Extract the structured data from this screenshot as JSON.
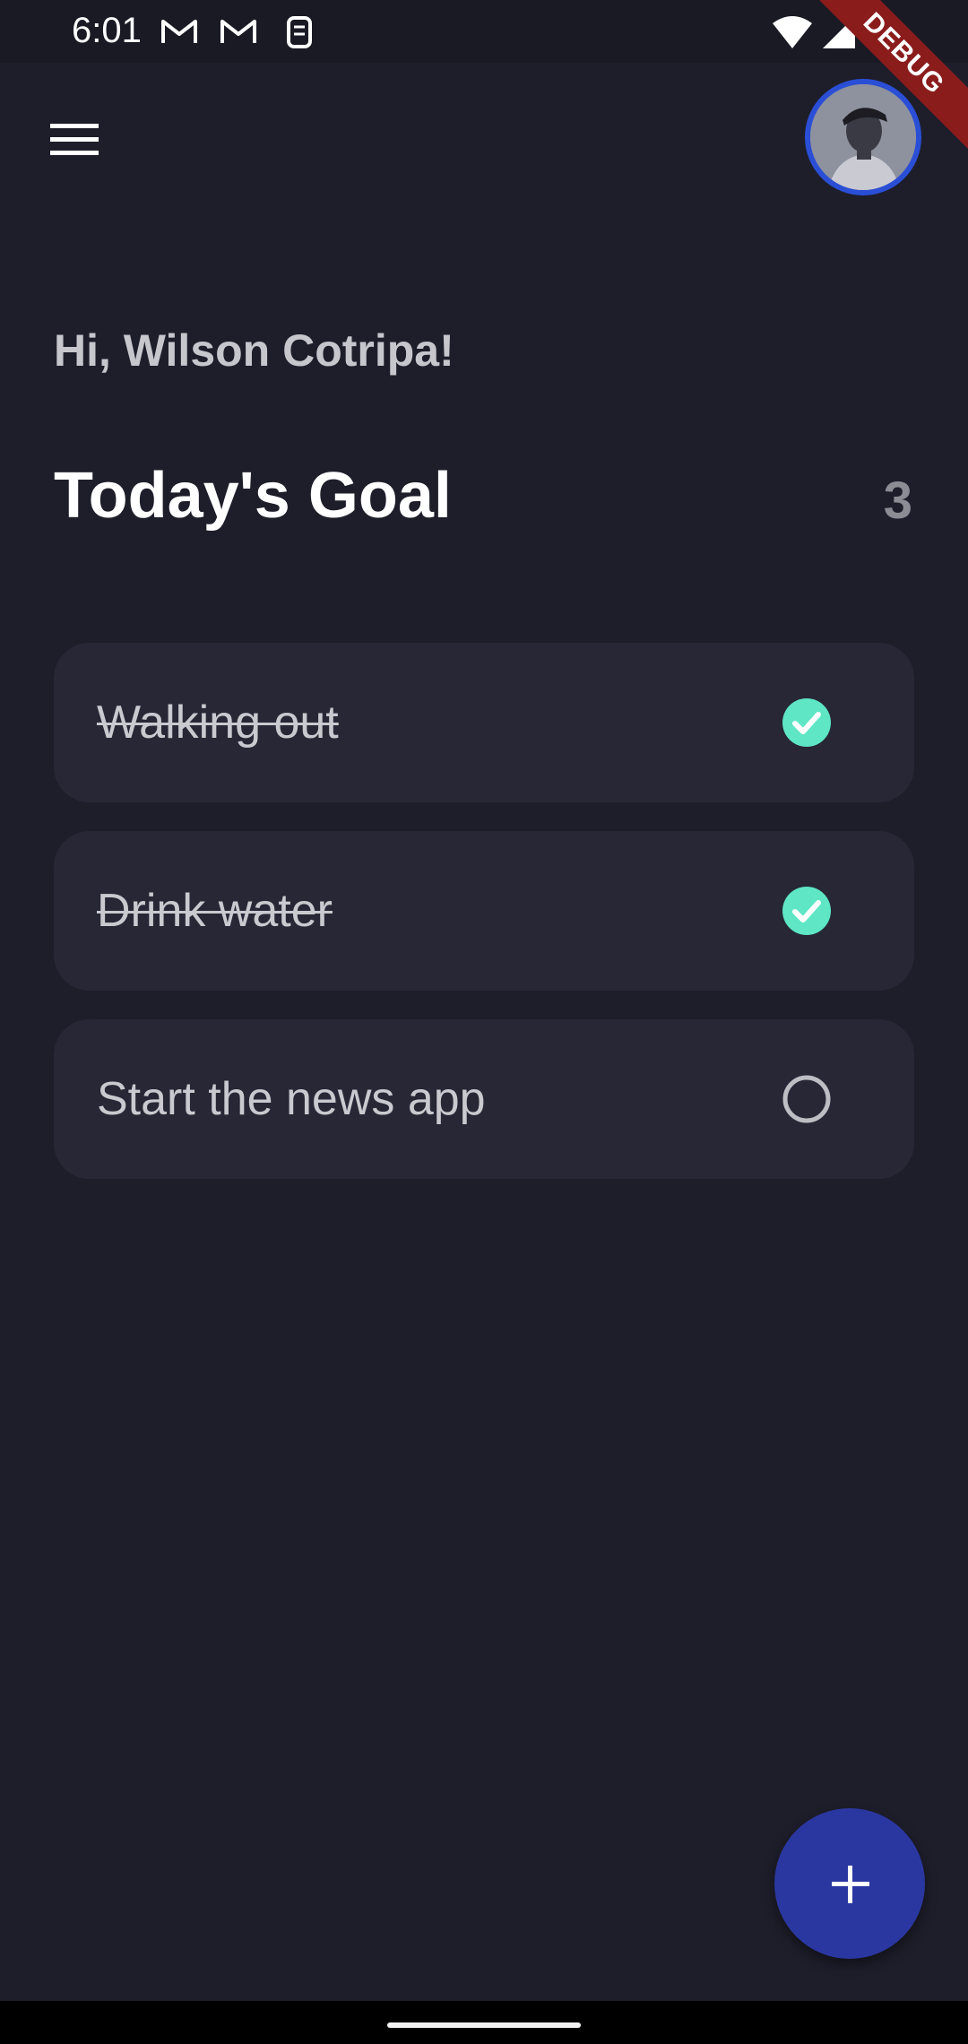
{
  "status_bar": {
    "time": "6:01",
    "icons": [
      "gmail-icon",
      "gmail-icon",
      "sim-icon",
      "wifi-icon",
      "signal-icon",
      "battery-icon"
    ]
  },
  "debug_banner": "DEBUG",
  "app_bar": {
    "menu_icon": "hamburger-menu-icon",
    "avatar": "user-avatar"
  },
  "greeting": "Hi, Wilson Cotripa!",
  "goal": {
    "title": "Today's Goal",
    "count": "3"
  },
  "tasks": [
    {
      "label": "Walking out",
      "done": true
    },
    {
      "label": "Drink water",
      "done": true
    },
    {
      "label": "Start the news app",
      "done": false
    }
  ],
  "fab": {
    "icon": "plus-icon"
  },
  "colors": {
    "background": "#1e1e2b",
    "card": "#272736",
    "check": "#5ee6c5",
    "accent": "#2b37a0",
    "avatar_border": "#2a4fd6"
  }
}
